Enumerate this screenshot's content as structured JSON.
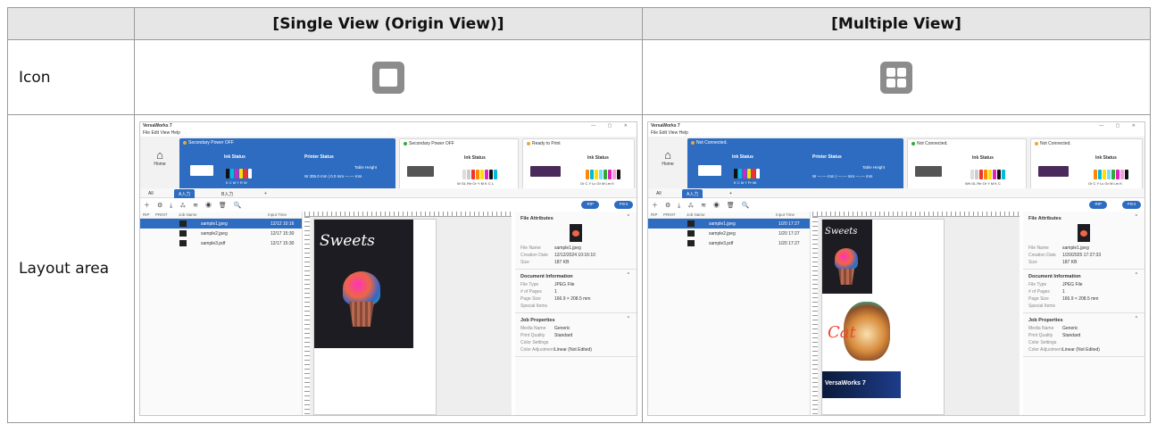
{
  "table": {
    "header": {
      "left": "[Single View (Origin View)]",
      "right": "[Multiple View]"
    },
    "rows": {
      "icon": "Icon",
      "layout": "Layout area"
    }
  },
  "left": {
    "window_title": "VersaWorks 7",
    "menu": "File  Edit  View  Help",
    "home": "Home",
    "card1_status": "Secondary Power OFF",
    "card2_status": "Secondary Power OFF",
    "card3_status": "Ready to Print",
    "ink_status": "Ink Status",
    "printer_status": "Printer Status",
    "table_height": "Table Height",
    "ink_letters1": "K C M Y R W",
    "ink_letters2": "W GL Re Or Y M K C L",
    "ink_letters3": "Or C Y Lc Gr M Lm K",
    "mm_text": "W 305.0 mm  |  0.0 mm  —.— mm",
    "tabs": [
      "All",
      "A入力",
      "B入力",
      "+"
    ],
    "rip": "RIP",
    "print": "Print",
    "job_headers": [
      "RIP",
      "PRINT",
      "Job Name",
      "Input Time"
    ],
    "jobs": [
      {
        "name": "sample1.jpeg",
        "time": "12/12 10:16"
      },
      {
        "name": "sample2.jpeg",
        "time": "12/17 15:30"
      },
      {
        "name": "sample3.pdf",
        "time": "12/17 15:30"
      }
    ],
    "art_text": "Sweets",
    "attr": {
      "file_title": "File Attributes",
      "file": [
        [
          "File Name",
          "sample1.jpeg"
        ],
        [
          "Creation Date",
          "12/12/2024 10:16:10"
        ],
        [
          "Size",
          "187 KB"
        ]
      ],
      "doc_title": "Document Information",
      "doc": [
        [
          "File Type",
          "JPEG File"
        ],
        [
          "# of Pages",
          "1"
        ],
        [
          "Page Size",
          "166.9 × 208.5 mm"
        ],
        [
          "Special Items",
          ""
        ]
      ],
      "job_title": "Job Properties",
      "job": [
        [
          "Media Name",
          "Generic"
        ],
        [
          "Print Quality",
          "Standard"
        ],
        [
          "Color Settings",
          ""
        ],
        [
          "Color Adjustment",
          "Linear (Not Edited)"
        ]
      ]
    }
  },
  "right": {
    "window_title": "VersaWorks 7",
    "menu": "File  Edit  View  Help",
    "home": "Home",
    "card1_status": "Not Connected.",
    "card2_status": "Not Connected.",
    "card3_status": "Not Connected.",
    "ink_status": "Ink Status",
    "printer_status": "Printer Status",
    "table_height": "Table Height",
    "ink_letters1": "K C M Y Pr Mt",
    "ink_letters2": "Wh GL Re Or Y M K C",
    "ink_letters3": "Or C Y Lc Gr M Lm K",
    "mm_text": "W —.— mm  |  —.— mm  —.— mm",
    "tabs": [
      "All",
      "A入力",
      "+"
    ],
    "rip": "RIP",
    "print": "Print",
    "job_headers": [
      "RIP",
      "PRINT",
      "Job Name",
      "Input Time"
    ],
    "jobs": [
      {
        "name": "sample1.jpeg",
        "time": "1/20 17:27"
      },
      {
        "name": "sample2.jpeg",
        "time": "1/20 17:27"
      },
      {
        "name": "sample3.pdf",
        "time": "1/20 17:27"
      }
    ],
    "art_text": "Sweets",
    "cat_text": "Cat",
    "vw_text": "VersaWorks 7",
    "attr": {
      "file_title": "File Attributes",
      "file": [
        [
          "File Name",
          "sample1.jpeg"
        ],
        [
          "Creation Date",
          "1/20/2025 17:27:33"
        ],
        [
          "Size",
          "187 KB"
        ]
      ],
      "doc_title": "Document Information",
      "doc": [
        [
          "File Type",
          "JPEG File"
        ],
        [
          "# of Pages",
          "1"
        ],
        [
          "Page Size",
          "166.9 × 208.5 mm"
        ],
        [
          "Special Items",
          ""
        ]
      ],
      "job_title": "Job Properties",
      "job": [
        [
          "Media Name",
          "Generic"
        ],
        [
          "Print Quality",
          "Standard"
        ],
        [
          "Color Settings",
          ""
        ],
        [
          "Color Adjustment",
          "Linear (Not Edited)"
        ]
      ]
    }
  },
  "colors": {
    "accent": "#2d6cc0",
    "icon_gray": "#8c8c8c",
    "header_bg": "#e6e6e6"
  },
  "icons": {
    "single": "single-square-icon",
    "multiple": "four-squares-icon"
  }
}
